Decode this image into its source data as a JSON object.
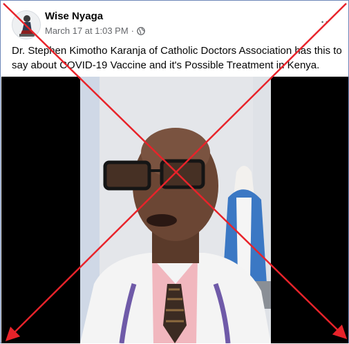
{
  "post": {
    "author": "Wise Nyaga",
    "date": "March 17 at 1:03 PM",
    "separator": "·",
    "privacy_icon": "globe-icon",
    "more_icon": "more-options-icon",
    "more_label": "··",
    "caption": "Dr. Stephen Kimotho Karanja of Catholic Doctors Association has this to say about COVID-19 Vaccine and it's Possible Treatment in Kenya."
  },
  "media": {
    "type": "video",
    "background_color": "#000000"
  },
  "overlay": {
    "mark": "red-x-cross",
    "color": "#e8232a"
  }
}
